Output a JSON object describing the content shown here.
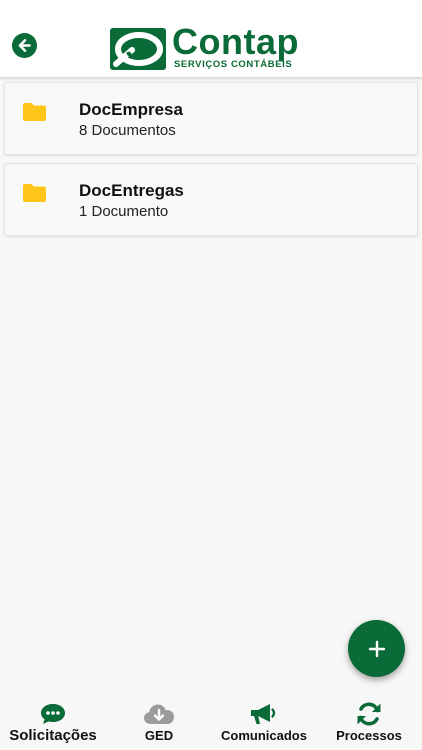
{
  "theme": {
    "brand_color": "#0a6b38",
    "folder_color": "#ffc61a",
    "inactive_icon_color": "#9b9b9b"
  },
  "header": {
    "back_icon": "arrow-left-icon",
    "logo": {
      "name": "Contap",
      "subtitle": "SERVIÇOS CONTÁBEIS"
    }
  },
  "folders": [
    {
      "title": "DocEmpresa",
      "subtitle": "8 Documentos",
      "icon": "folder-icon"
    },
    {
      "title": "DocEntregas",
      "subtitle": "1 Documento",
      "icon": "folder-icon"
    }
  ],
  "fab": {
    "icon": "plus-icon"
  },
  "tabbar": {
    "active": "Solicitações",
    "tabs": [
      {
        "label": "Solicitações",
        "icon": "chat-bubble-icon"
      },
      {
        "label": "GED",
        "icon": "cloud-download-icon"
      },
      {
        "label": "Comunicados",
        "icon": "megaphone-icon"
      },
      {
        "label": "Processos",
        "icon": "sync-icon"
      }
    ]
  }
}
